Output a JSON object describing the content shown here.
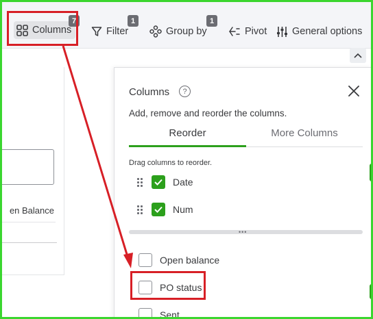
{
  "toolbar": {
    "columns_label": "Columns",
    "columns_badge": "7",
    "filter_label": "Filter",
    "filter_badge": "1",
    "group_by_label": "Group by",
    "group_by_badge": "1",
    "pivot_label": "Pivot",
    "general_options_label": "General options"
  },
  "background": {
    "column_header_fragment": "en Balance"
  },
  "panel": {
    "title": "Columns",
    "help_symbol": "?",
    "description": "Add, remove and reorder the columns.",
    "tabs": [
      {
        "label": "Reorder",
        "active": true
      },
      {
        "label": "More Columns",
        "active": false
      }
    ],
    "drag_hint": "Drag columns to reorder.",
    "selected_columns": [
      {
        "label": "Date",
        "checked": true
      },
      {
        "label": "Num",
        "checked": true
      }
    ],
    "other_columns": [
      {
        "label": "Open balance",
        "checked": false
      },
      {
        "label": "PO status",
        "checked": false
      },
      {
        "label": "Sent",
        "checked": false
      }
    ]
  },
  "colors": {
    "accent_green": "#2ca01c",
    "annotation_red": "#d71f26",
    "frame_green": "#3bd62f",
    "badge_gray": "#6b6c72"
  }
}
